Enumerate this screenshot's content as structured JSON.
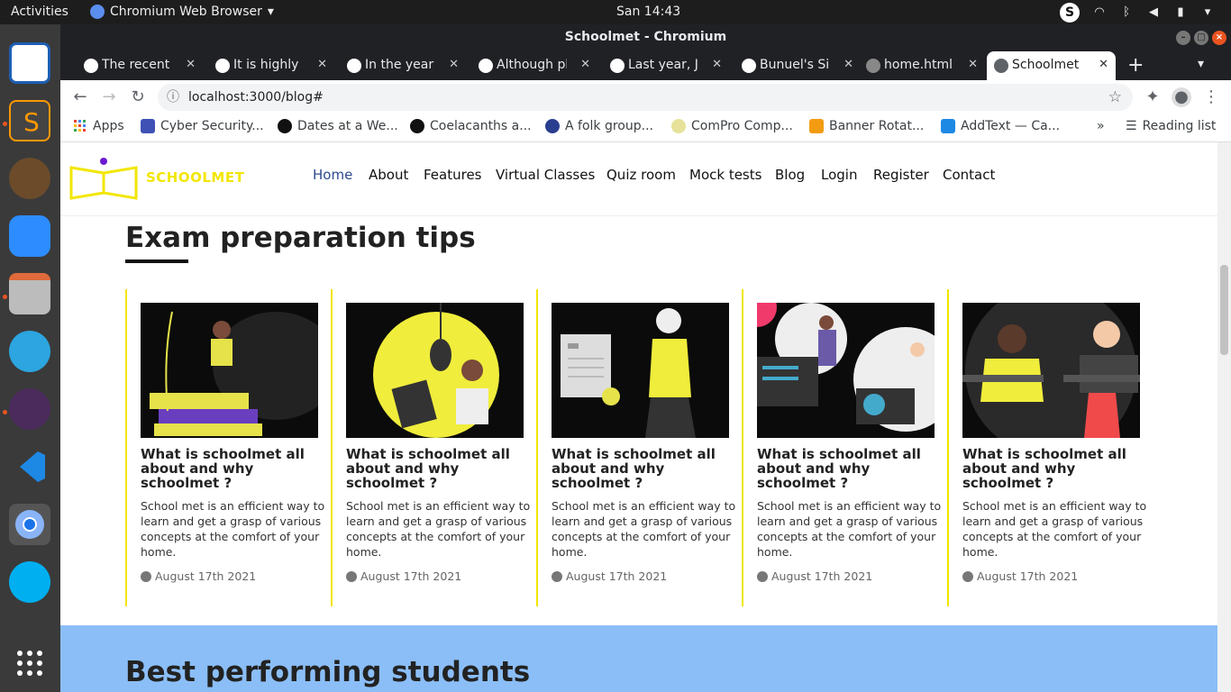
{
  "topbar": {
    "activities": "Activities",
    "app_name": "Chromium Web Browser",
    "clock": "San 14:43"
  },
  "window": {
    "title": "Schoolmet - Chromium"
  },
  "tabs": [
    {
      "label": "The recent r"
    },
    {
      "label": "It is highly li"
    },
    {
      "label": "In the year f"
    },
    {
      "label": "Although pl"
    },
    {
      "label": "Last year, Jo"
    },
    {
      "label": "Bunuel's Sig"
    },
    {
      "label": "home.html"
    },
    {
      "label": "Schoolmet"
    }
  ],
  "address": {
    "url": "localhost:3000/blog#"
  },
  "bookmarks": [
    {
      "label": "Apps"
    },
    {
      "label": "Cyber Security..."
    },
    {
      "label": "Dates at a We..."
    },
    {
      "label": "Coelacanths a..."
    },
    {
      "label": "A folk group..."
    },
    {
      "label": "ComPro Comp..."
    },
    {
      "label": "Banner Rotat..."
    },
    {
      "label": "AddText — Ca..."
    }
  ],
  "reading_list": "Reading list",
  "site": {
    "logo": "SCHOOLMET",
    "menu": [
      "Home",
      "About",
      "Features",
      "Virtual Classes",
      "Quiz room",
      "Mock tests",
      "Blog",
      "Login",
      "Register",
      "Contact"
    ],
    "section_title": "Exam preparation tips",
    "cards": [
      {
        "title": "What is schoolmet all about and why schoolmet ?",
        "text": "School met is an efficient way to learn and get a grasp of various concepts at the comfort of your home.",
        "date": "August 17th 2021"
      },
      {
        "title": "What is schoolmet all about and why schoolmet ?",
        "text": "School met is an efficient way to learn and get a grasp of various concepts at the comfort of your home.",
        "date": "August 17th 2021"
      },
      {
        "title": "What is schoolmet all about and why schoolmet ?",
        "text": "School met is an efficient way to learn and get a grasp of various concepts at the comfort of your home.",
        "date": "August 17th 2021"
      },
      {
        "title": "What is schoolmet all about and why schoolmet ?",
        "text": "School met is an efficient way to learn and get a grasp of various concepts at the comfort of your home.",
        "date": "August 17th 2021"
      },
      {
        "title": "What is schoolmet all about and why schoolmet ?",
        "text": "School met is an efficient way to learn and get a grasp of various concepts at the comfort of your home.",
        "date": "August 17th 2021"
      }
    ],
    "best_title": "Best performing students"
  },
  "colors": {
    "accent_yellow": "#f2e600",
    "nav_active": "#2d4b8f",
    "band_blue": "#8bbef7"
  }
}
